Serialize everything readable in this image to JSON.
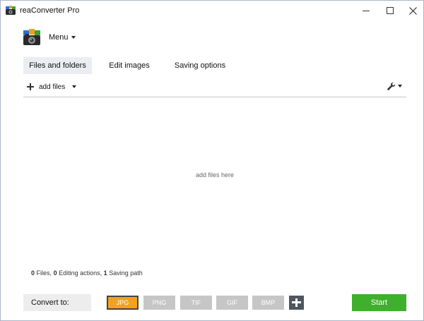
{
  "window": {
    "title": "reaConverter Pro",
    "icons": {
      "app": "app-logo-icon",
      "minimize": "minimize-icon",
      "maximize": "maximize-icon",
      "close": "close-icon"
    }
  },
  "menu": {
    "label": "Menu",
    "icon": "app-logo-icon"
  },
  "tabs": [
    {
      "label": "Files and folders",
      "active": true
    },
    {
      "label": "Edit images",
      "active": false
    },
    {
      "label": "Saving options",
      "active": false
    }
  ],
  "toolbar": {
    "add_files_label": "add files",
    "icons": {
      "add": "plus-icon",
      "settings": "wrench-icon"
    }
  },
  "dropzone": {
    "hint": "add files here"
  },
  "status": {
    "files_count": "0",
    "files_label": "Files,",
    "editing_count": "0",
    "editing_label": "Editing actions,",
    "saving_count": "1",
    "saving_label": "Saving path"
  },
  "convert": {
    "label": "Convert to:",
    "formats": [
      {
        "label": "JPG",
        "selected": true
      },
      {
        "label": "PNG",
        "selected": false
      },
      {
        "label": "TIF",
        "selected": false
      },
      {
        "label": "GIF",
        "selected": false
      },
      {
        "label": "BMP",
        "selected": false
      }
    ],
    "start_label": "Start"
  },
  "colors": {
    "selected_format": "#f5a11e",
    "inactive_format": "#c6c6c6",
    "start": "#3fb02c",
    "add_format": "#4e565f",
    "active_tab": "#eaeef2"
  }
}
